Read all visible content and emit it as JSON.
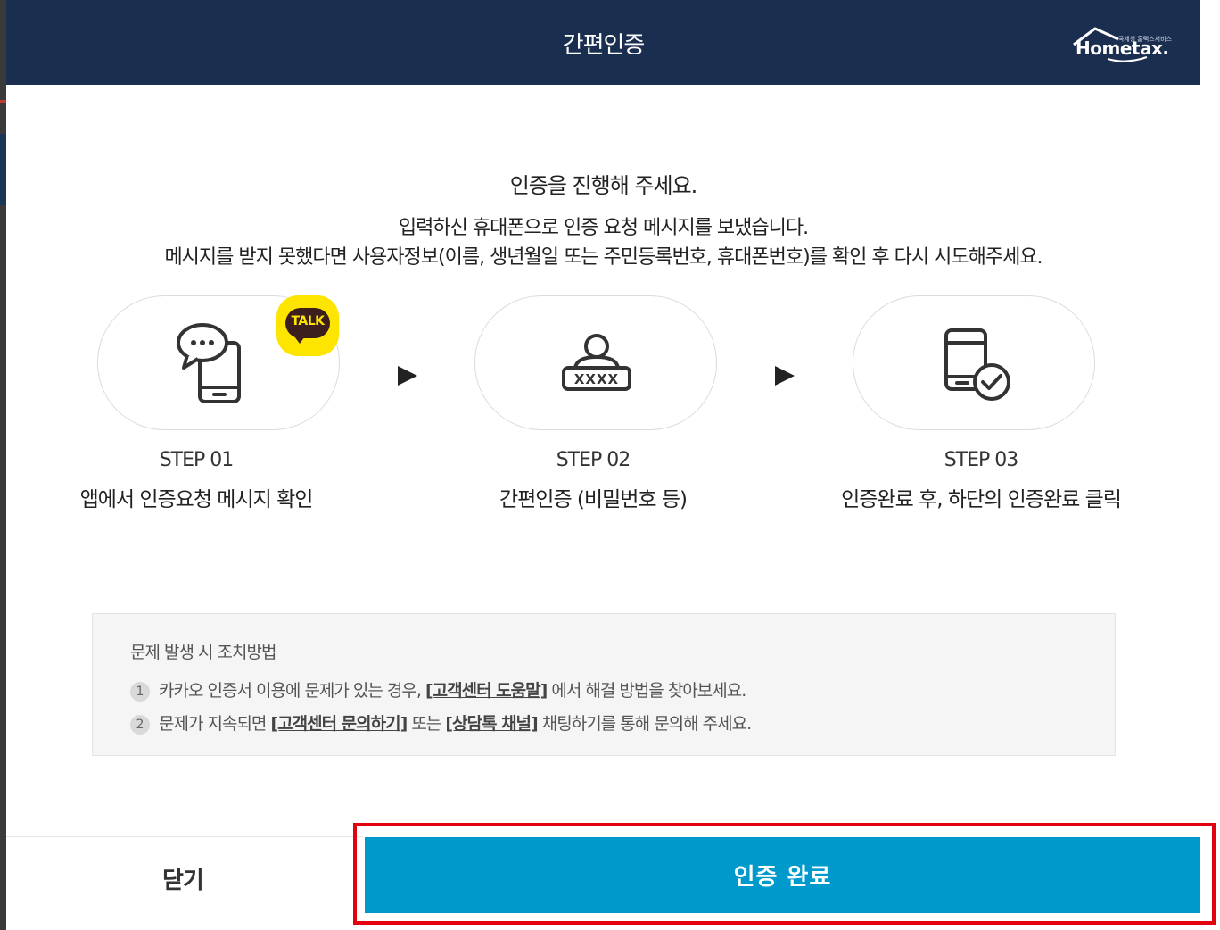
{
  "header": {
    "title": "간편인증",
    "logo_text": "Hometax.",
    "logo_tagline": "국세청 홈택스서비스"
  },
  "intro": {
    "title": "인증을 진행해 주세요.",
    "line1": "입력하신 휴대폰으로 인증 요청 메시지를 보냈습니다.",
    "line2": "메시지를 받지 못했다면 사용자정보(이름, 생년월일 또는 주민등록번호, 휴대폰번호)를 확인 후 다시 시도해주세요."
  },
  "steps": [
    {
      "num": "STEP 01",
      "desc": "앱에서 인증요청 메시지 확인",
      "icon": "chat-phone-icon",
      "badge": "TALK"
    },
    {
      "num": "STEP 02",
      "desc": "간편인증 (비밀번호 등)",
      "icon": "user-password-icon"
    },
    {
      "num": "STEP 03",
      "desc": "인증완료 후, 하단의 인증완료 클릭",
      "icon": "phone-check-icon"
    }
  ],
  "help": {
    "title": "문제 발생 시 조치방법",
    "items": [
      {
        "num": "1",
        "pre": "카카오 인증서 이용에 문제가 있는 경우, ",
        "link": "[고객센터 도움말]",
        "post": " 에서 해결 방법을 찾아보세요."
      },
      {
        "num": "2",
        "pre": "문제가 지속되면 ",
        "link": "[고객센터 문의하기]",
        "mid": " 또는 ",
        "link2": "[상담톡 채널]",
        "post": " 채팅하기를 통해 문의해 주세요."
      }
    ]
  },
  "footer": {
    "close_label": "닫기",
    "confirm_label": "인증 완료"
  },
  "colors": {
    "header_bg": "#1a2e50",
    "confirm_bg": "#0099cc",
    "highlight": "#e3000f",
    "kakao_yellow": "#fee500"
  }
}
